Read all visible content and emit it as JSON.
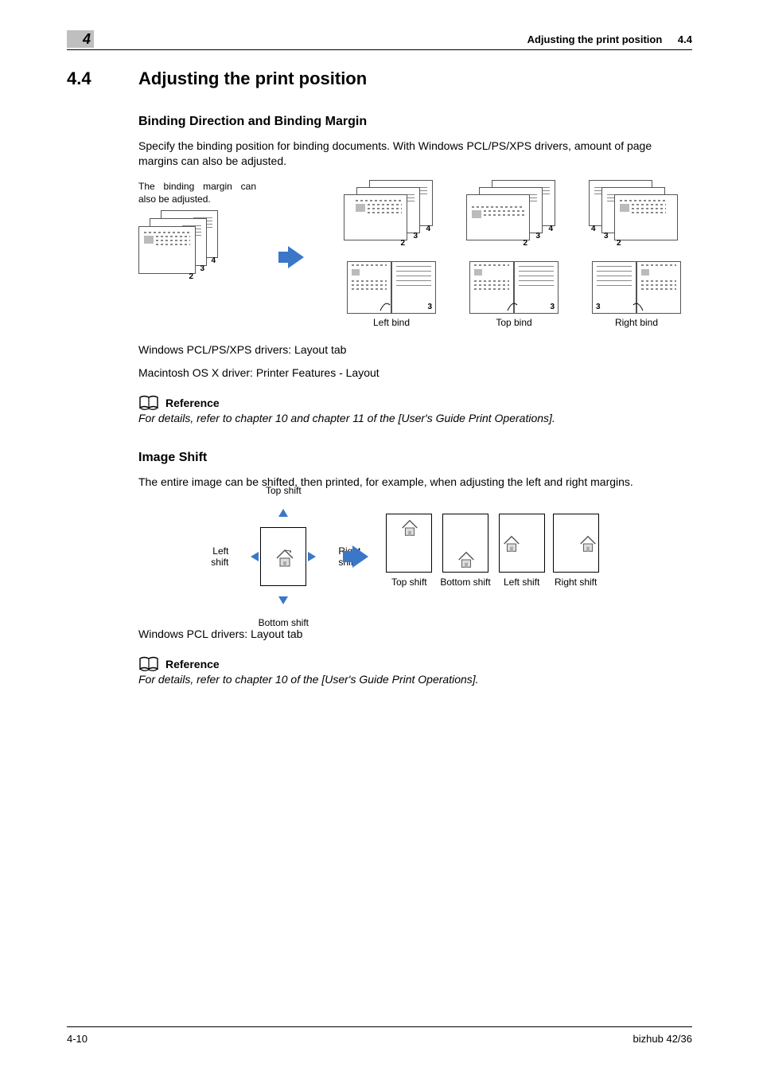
{
  "header": {
    "chapter_badge": "4",
    "title": "Adjusting the print position",
    "section_num_right": "4.4"
  },
  "section": {
    "num": "4.4",
    "title": "Adjusting the print position"
  },
  "binding": {
    "heading": "Binding Direction and Binding Margin",
    "intro": "Specify the binding position for binding documents. With Windows PCL/PS/XPS drivers, amount of page margins can also be adjusted.",
    "source_caption": "The binding margin can also be adjusted.",
    "labels": {
      "left": "Left bind",
      "top": "Top bind",
      "right": "Right bind"
    },
    "page_numbers": [
      "2",
      "3",
      "4"
    ],
    "notes": [
      "Windows PCL/PS/XPS drivers: Layout tab",
      "Macintosh OS X driver: Printer Features - Layout"
    ],
    "reference_label": "Reference",
    "reference_text": "For details, refer to chapter 10 and chapter 11 of the [User's Guide Print Operations]."
  },
  "image_shift": {
    "heading": "Image Shift",
    "intro": "The entire image can be shifted, then printed, for example, when adjusting the left and right margins.",
    "labels": {
      "top": "Top shift",
      "bottom": "Bottom shift",
      "left": "Left shift",
      "right": "Right shift"
    },
    "result_captions": [
      "Top shift",
      "Bottom shift",
      "Left shift",
      "Right shift"
    ],
    "notes": [
      "Windows PCL drivers: Layout tab"
    ],
    "reference_label": "Reference",
    "reference_text": "For details, refer to chapter 10 of the [User's Guide Print Operations]."
  },
  "footer": {
    "page": "4-10",
    "product": "bizhub 42/36"
  }
}
